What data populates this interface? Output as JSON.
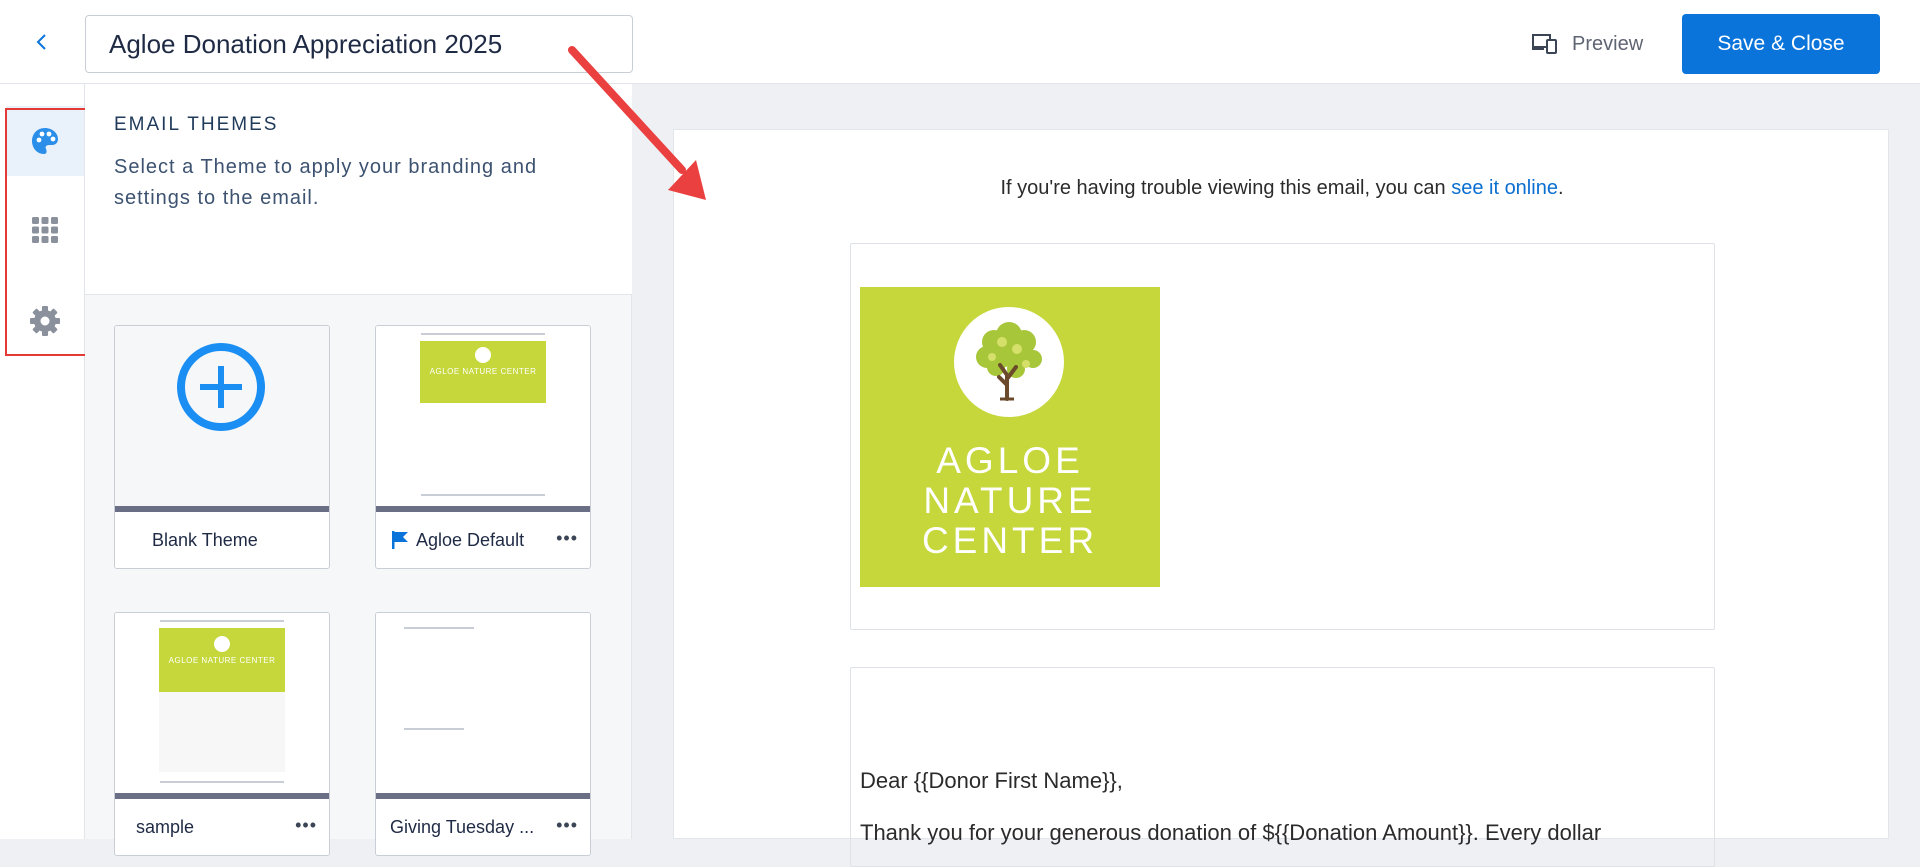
{
  "header": {
    "title_value": "Agloe Donation Appreciation 2025",
    "preview_label": "Preview",
    "save_close_label": "Save & Close"
  },
  "rail": {
    "items": [
      {
        "icon": "palette-icon",
        "active": true
      },
      {
        "icon": "apps-grid-icon",
        "active": false
      },
      {
        "icon": "gear-icon",
        "active": false
      }
    ]
  },
  "themes": {
    "title": "EMAIL THEMES",
    "description": "Select a Theme to apply your branding and settings to the email.",
    "cards": [
      {
        "label": "Blank Theme"
      },
      {
        "label": "Agloe Default",
        "flag_icon": "flag-icon",
        "menu": "•••"
      },
      {
        "label": "sample",
        "menu": "•••"
      },
      {
        "label": "Giving Tuesday ...",
        "menu": "•••"
      }
    ],
    "thumb_logo_text": "AGLOE NATURE CENTER"
  },
  "email": {
    "trouble_text": "If you're having trouble viewing this email, you can ",
    "trouble_link": "see it online",
    "trouble_end": ".",
    "logo_line1": "AGLOE",
    "logo_line2": "NATURE",
    "logo_line3": "CENTER",
    "greeting": "Dear {{Donor First Name}},",
    "thanks": "Thank you for your generous donation of ${{Donation Amount}}. Every dollar"
  },
  "colors": {
    "primary": "#0a74da",
    "brand_green": "#c5d73a",
    "highlight_red": "#e53935"
  }
}
